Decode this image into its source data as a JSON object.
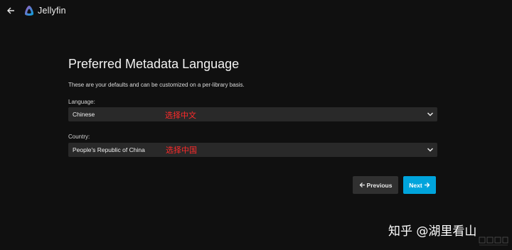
{
  "app": {
    "name": "Jellyfin"
  },
  "header": {
    "back_icon": "arrow-left-icon",
    "logo_icon": "jellyfin-logo-icon"
  },
  "wizard": {
    "title": "Preferred Metadata Language",
    "description": "These are your defaults and can be customized on a per-library basis.",
    "language": {
      "label": "Language:",
      "value": "Chinese",
      "annotation": "选择中文"
    },
    "country": {
      "label": "Country:",
      "value": "People's Republic of China",
      "annotation": "选择中国"
    },
    "previous_label": "Previous",
    "next_label": "Next"
  },
  "watermark": {
    "text": "知乎 @湖里看山"
  },
  "colors": {
    "background": "#101010",
    "select_bg": "#292929",
    "accent": "#00a4dc",
    "annotation": "#ff2a2a",
    "logo_gradient_start": "#aa5cc3",
    "logo_gradient_end": "#00a4dc"
  }
}
